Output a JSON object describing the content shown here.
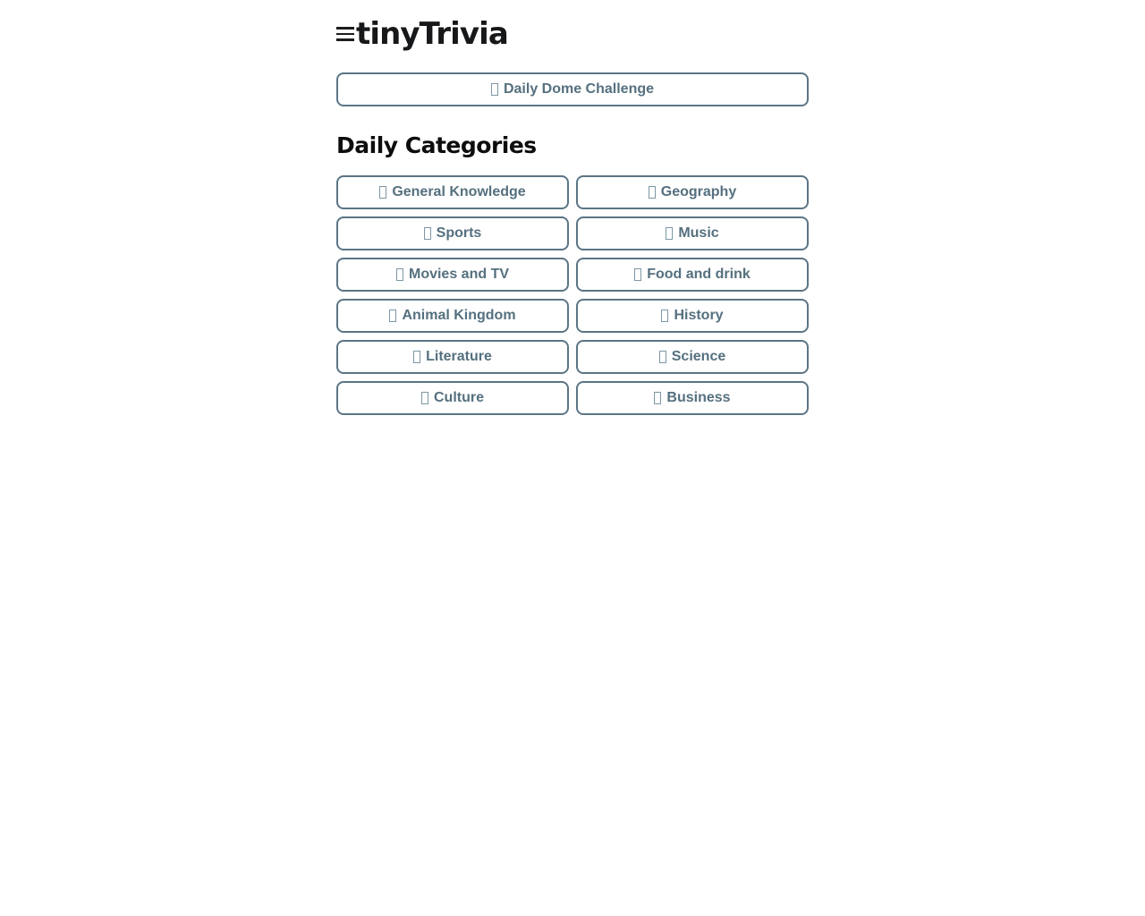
{
  "header": {
    "menu_icon": "hamburger-menu-icon",
    "brand": "tinyTrivia"
  },
  "main": {
    "daily_dome": {
      "label": "Daily Dome Challenge",
      "icon": "missing-glyph-box"
    },
    "section_title": "Daily Categories",
    "categories": [
      {
        "label": "General Knowledge",
        "icon": "missing-glyph-box"
      },
      {
        "label": "Geography",
        "icon": "missing-glyph-box"
      },
      {
        "label": "Sports",
        "icon": "missing-glyph-box"
      },
      {
        "label": "Music",
        "icon": "missing-glyph-box"
      },
      {
        "label": "Movies and TV",
        "icon": "missing-glyph-box"
      },
      {
        "label": "Food and drink",
        "icon": "missing-glyph-box"
      },
      {
        "label": "Animal Kingdom",
        "icon": "missing-glyph-box"
      },
      {
        "label": "History",
        "icon": "missing-glyph-box"
      },
      {
        "label": "Literature",
        "icon": "missing-glyph-box"
      },
      {
        "label": "Science",
        "icon": "missing-glyph-box"
      },
      {
        "label": "Culture",
        "icon": "missing-glyph-box"
      },
      {
        "label": "Business",
        "icon": "missing-glyph-box"
      }
    ]
  },
  "colors": {
    "background": "#ffffff",
    "button_border": "#5b7585",
    "button_text": "#55707f",
    "heading_text": "#0d0d0f",
    "brand_text": "#17181a"
  }
}
